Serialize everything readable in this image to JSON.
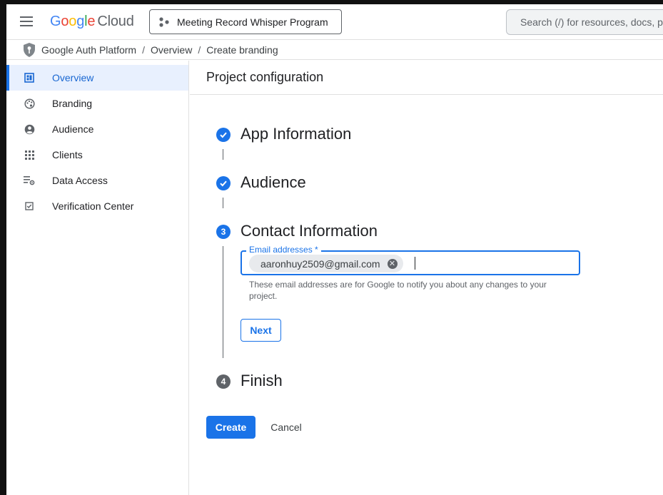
{
  "topbar": {
    "logo_letters": [
      "G",
      "o",
      "o",
      "g",
      "l",
      "e"
    ],
    "logo_suffix": "Cloud",
    "project_name": "Meeting Record Whisper Program",
    "search_placeholder": "Search (/) for resources, docs, products"
  },
  "breadcrumb": {
    "items": [
      "Google Auth Platform",
      "Overview",
      "Create branding"
    ],
    "separator": "/"
  },
  "sidebar": {
    "items": [
      {
        "label": "Overview",
        "icon": "dashboard-icon",
        "active": true
      },
      {
        "label": "Branding",
        "icon": "palette-icon",
        "active": false
      },
      {
        "label": "Audience",
        "icon": "account-circle-icon",
        "active": false
      },
      {
        "label": "Clients",
        "icon": "apps-grid-icon",
        "active": false
      },
      {
        "label": "Data Access",
        "icon": "list-settings-icon",
        "active": false
      },
      {
        "label": "Verification Center",
        "icon": "checkbox-icon",
        "active": false
      }
    ]
  },
  "main": {
    "title": "Project configuration",
    "steps": [
      {
        "number": "1",
        "title": "App Information",
        "status": "done"
      },
      {
        "number": "2",
        "title": "Audience",
        "status": "done"
      },
      {
        "number": "3",
        "title": "Contact Information",
        "status": "current"
      },
      {
        "number": "4",
        "title": "Finish",
        "status": "pending"
      }
    ],
    "email_field": {
      "label": "Email addresses *",
      "chip_value": "aaronhuy2509@gmail.com",
      "hint": "These email addresses are for Google to notify you about any changes to your project."
    },
    "next_label": "Next",
    "create_label": "Create",
    "cancel_label": "Cancel"
  },
  "colors": {
    "accent": "#1a73e8",
    "active_bg": "#e8f0fe",
    "pending_step": "#5f6368"
  }
}
